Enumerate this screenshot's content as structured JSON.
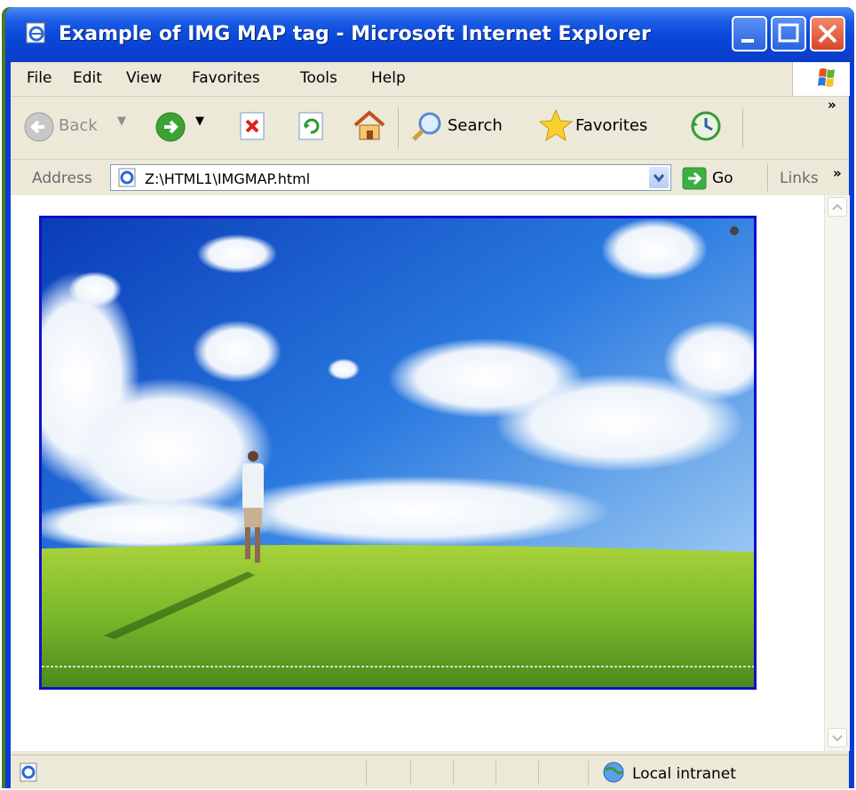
{
  "window": {
    "title": "Example of IMG MAP tag - Microsoft Internet Explorer"
  },
  "menu": [
    "File",
    "Edit",
    "View",
    "Favorites",
    "Tools",
    "Help"
  ],
  "toolbar": {
    "back_label": "Back",
    "search_label": "Search",
    "favorites_label": "Favorites",
    "overflow": "»"
  },
  "address": {
    "label": "Address",
    "url": "Z:\\HTML1\\IMGMAP.html",
    "go_label": "Go",
    "links_label": "Links",
    "links_overflow": "»"
  },
  "status": {
    "zone": "Local intranet"
  },
  "colors": {
    "titlebar": "#0a47d8",
    "chrome": "#ece9d8",
    "image_border": "#1010c8",
    "caption": "#f08000"
  },
  "icons": [
    "ie-page-icon",
    "minimize-icon",
    "maximize-icon",
    "close-icon",
    "windows-flag-icon",
    "back-arrow-icon",
    "forward-arrow-icon",
    "stop-icon",
    "refresh-icon",
    "home-icon",
    "search-icon",
    "favorites-star-icon",
    "history-icon",
    "go-arrow-icon",
    "globe-icon"
  ]
}
